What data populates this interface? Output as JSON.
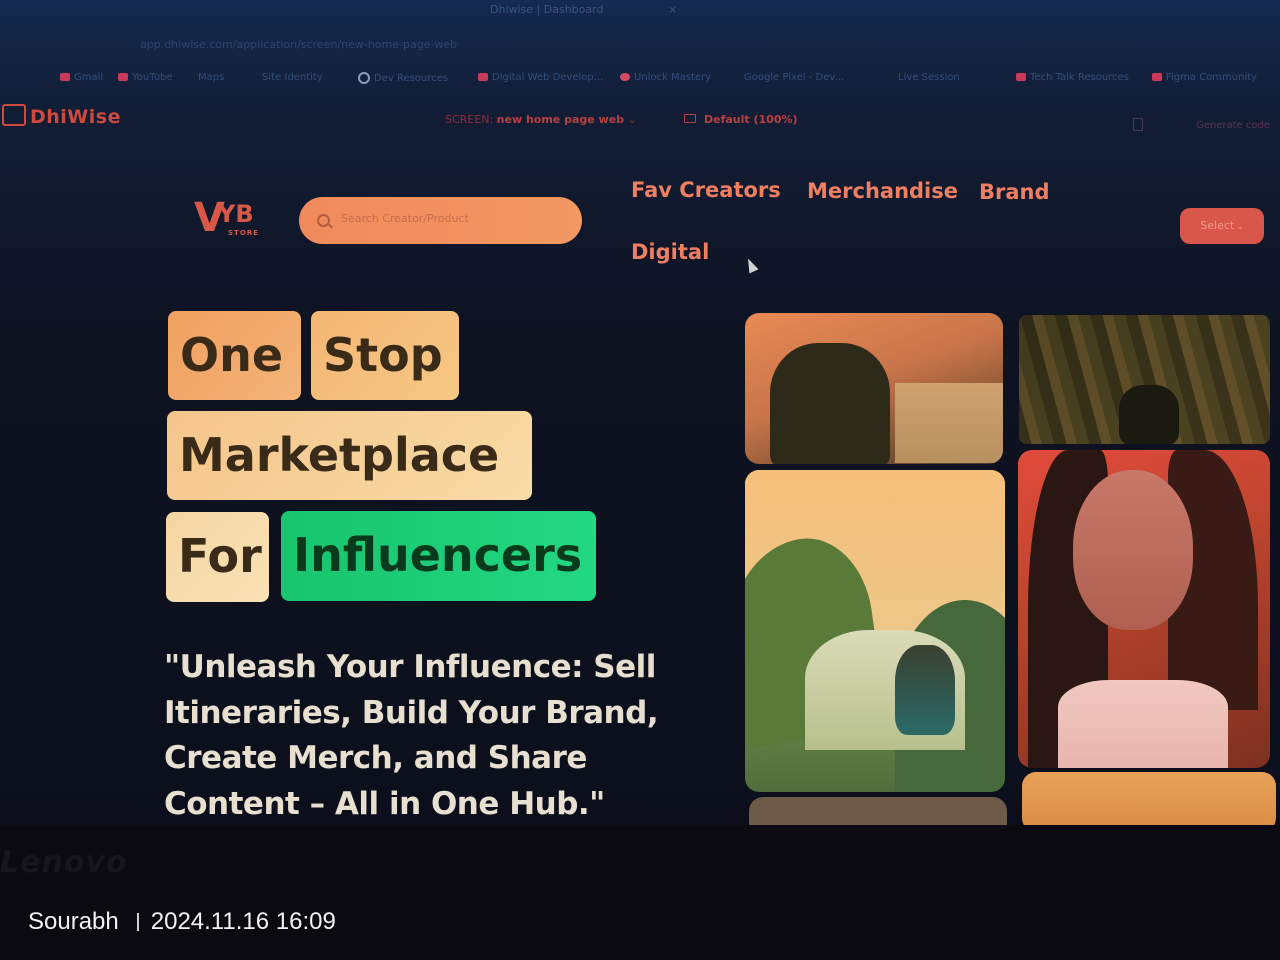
{
  "browser": {
    "tab_title": "Dhiwise | Dashboard",
    "tab_close": "×",
    "url": "app.dhiwise.com/application/screen/new-home-page-web",
    "bookmarks": [
      "Gmail",
      "YouTube",
      "Maps",
      "Site Identity",
      "Dev Resources",
      "Digital Web Develop...",
      "Unlock Mastery",
      "Google Pixel - Dev...",
      "Live Session",
      "Tech Talk Resources",
      "Figma Community"
    ]
  },
  "dhiwise": {
    "logo": "DhiWise",
    "screen_label": "SCREEN:",
    "screen_name": "new home page web",
    "zoom": "Default (100%)",
    "generate": "Generate code"
  },
  "app": {
    "logo_v": "V",
    "logo_yb": "YB",
    "logo_store": "STORE",
    "search": {
      "placeholder": "Search Creator/Product"
    },
    "nav": [
      "Fav Creators",
      "Merchandise",
      "Brand",
      "Digital"
    ],
    "select_label": "Select",
    "hero": {
      "word_1": "One",
      "word_2": "Stop",
      "word_3": "Marketplace",
      "word_4": "For",
      "word_5": "Influencers",
      "tagline": "\"Unleash Your Influence: Sell Itineraries, Build Your Brand, Create Merch, and Share Content – All in One Hub.\""
    }
  },
  "device": {
    "brand": "Lenovo",
    "watermark_name": "Sourabh",
    "watermark_time": "2024.11.16 16:09"
  },
  "colors": {
    "accent": "#f07f62",
    "chip_green": "#1ed078",
    "chip_orange": "#f0a060"
  }
}
